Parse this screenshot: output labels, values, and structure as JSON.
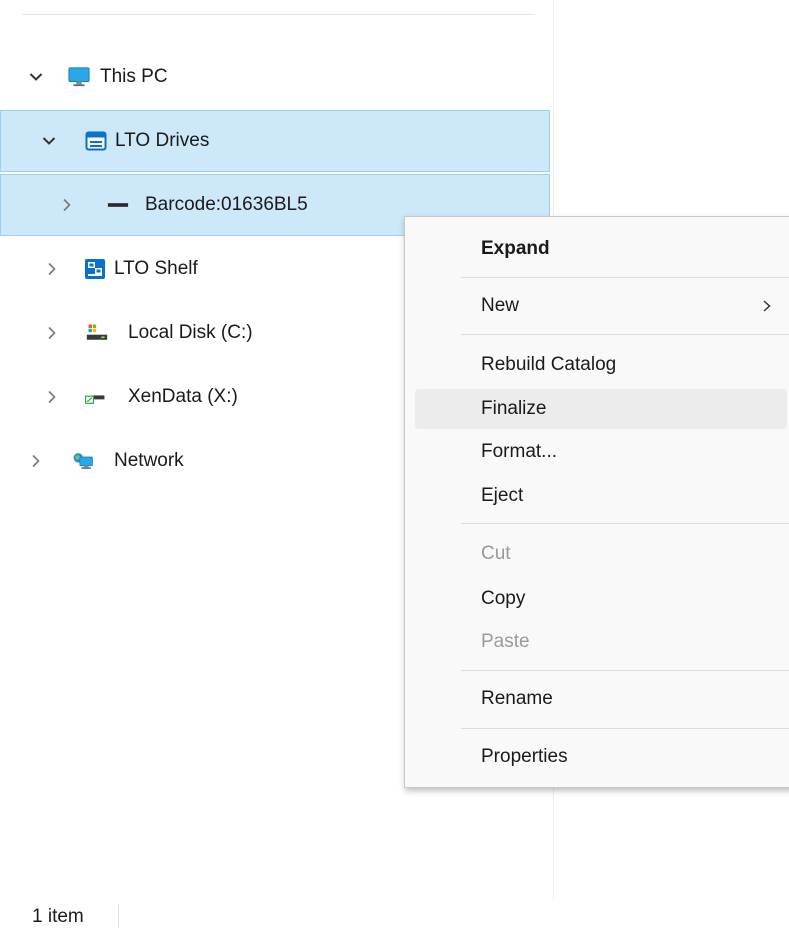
{
  "nav_tree": {
    "items": [
      {
        "label": "This PC",
        "icon": "monitor-icon",
        "chevron": "expanded"
      },
      {
        "label": "LTO Drives",
        "icon": "lto-drives-icon",
        "chevron": "expanded",
        "selected": true
      },
      {
        "label": "Barcode:01636BL5",
        "icon": "tape-cartridge-icon",
        "chevron": "collapsed",
        "selected": true
      },
      {
        "label": "LTO Shelf",
        "icon": "lto-shelf-icon",
        "chevron": "collapsed"
      },
      {
        "label": "Local Disk (C:)",
        "icon": "local-disk-icon",
        "chevron": "collapsed"
      },
      {
        "label": "XenData (X:)",
        "icon": "network-drive-icon",
        "chevron": "collapsed"
      },
      {
        "label": "Network",
        "icon": "network-icon",
        "chevron": "collapsed"
      }
    ]
  },
  "context_menu": {
    "items": [
      {
        "label": "Expand",
        "bold": true
      },
      {
        "label": "New",
        "has_submenu": true
      },
      {
        "label": "Rebuild Catalog"
      },
      {
        "label": "Finalize",
        "hovered": true
      },
      {
        "label": "Format..."
      },
      {
        "label": "Eject"
      },
      {
        "label": "Cut",
        "disabled": true
      },
      {
        "label": "Copy"
      },
      {
        "label": "Paste",
        "disabled": true
      },
      {
        "label": "Rename"
      },
      {
        "label": "Properties"
      }
    ]
  },
  "status_bar": {
    "item_count": "1 item"
  },
  "colors": {
    "selection_bg": "#cce8f9",
    "selection_border": "#99d1f5",
    "menu_bg": "#f9f9f9",
    "menu_hover": "#ececec",
    "disabled_text": "#9a9a9a",
    "icon_blue": "#0a6fcf"
  }
}
